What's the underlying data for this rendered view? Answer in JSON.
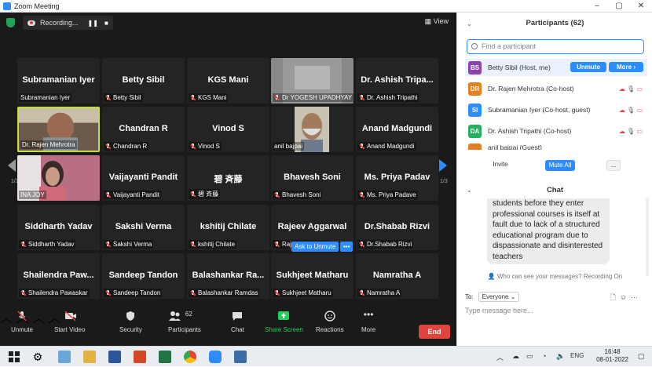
{
  "window": {
    "title": "Zoom Meeting",
    "min": "–",
    "max": "▢",
    "close": "✕"
  },
  "topbar": {
    "recording": "Recording...",
    "pause": "❚❚",
    "stop": "■",
    "view": "View"
  },
  "tiles": [
    {
      "big": "Subramanian Iyer",
      "small": "Subramanian Iyer",
      "muted": false
    },
    {
      "big": "Betty Sibil",
      "small": "Betty Sibil",
      "muted": true
    },
    {
      "big": "KGS Mani",
      "small": "KGS Mani",
      "muted": true
    },
    {
      "big": "",
      "small": "Dr YOGESH UPADHYAY",
      "muted": true,
      "video": "blur"
    },
    {
      "big": "Dr. Ashish Tripa...",
      "small": "Dr. Ashish Tripathi",
      "muted": true
    },
    {
      "big": "",
      "small": "Dr. Rajen Mehrotra",
      "muted": false,
      "video": "man",
      "active": true
    },
    {
      "big": "Chandran R",
      "small": "Chandran R",
      "muted": true
    },
    {
      "big": "Vinod S",
      "small": "Vinod S",
      "muted": true
    },
    {
      "big": "",
      "small": "anil bajpai",
      "muted": false,
      "video": "elder"
    },
    {
      "big": "Anand Madgundi",
      "small": "Anand Madgundi",
      "muted": true
    },
    {
      "big": "",
      "small": "INA JOY",
      "muted": false,
      "video": "woman"
    },
    {
      "big": "Vaijayanti Pandit",
      "small": "Vaijayanti Pandit",
      "muted": true
    },
    {
      "big": "碧 斉藤",
      "small": "碧 斉藤",
      "muted": true
    },
    {
      "big": "Bhavesh Soni",
      "small": "Bhavesh Soni",
      "muted": true
    },
    {
      "big": "Ms. Priya Padav",
      "small": "Ms. Priya Padave",
      "muted": true
    },
    {
      "big": "Siddharth Yadav",
      "small": "Siddharth Yadav",
      "muted": true
    },
    {
      "big": "Sakshi Verma",
      "small": "Sakshi Verma",
      "muted": true
    },
    {
      "big": "kshitij Chilate",
      "small": "kshitij Chilate",
      "muted": true
    },
    {
      "big": "Rajeev Aggarwal",
      "small": "Rajeev Aggarwal",
      "muted": true
    },
    {
      "big": "Dr.Shabab Rizvi",
      "small": "Dr.Shabab Rizvi",
      "muted": true
    },
    {
      "big": "Shailendra Paw...",
      "small": "Shailendra Pawaskar",
      "muted": true
    },
    {
      "big": "Sandeep Tandon",
      "small": "Sandeep Tandon",
      "muted": true
    },
    {
      "big": "Balashankar Ra...",
      "small": "Balashankar Ramdas",
      "muted": true
    },
    {
      "big": "Sukhjeet Matharu",
      "small": "Sukhjeet Matharu",
      "muted": true
    },
    {
      "big": "Namratha A",
      "small": "Namratha A",
      "muted": true
    }
  ],
  "pager": {
    "left": "1/3",
    "right": "1/3"
  },
  "ask_unmute": "Ask to Unmute",
  "ask_more": "•••",
  "toolbar": {
    "unmute": "Unmute",
    "video": "Start Video",
    "security": "Security",
    "participants": "Participants",
    "participants_count": "62",
    "chat": "Chat",
    "share": "Share Screen",
    "reactions": "Reactions",
    "more": "More",
    "end": "End"
  },
  "participants_panel": {
    "title": "Participants (62)",
    "search_placeholder": "Find a participant",
    "rows": [
      {
        "initials": "BS",
        "name": "Betty Sibil (Host, me)",
        "color": "#8e44ad"
      },
      {
        "initials": "DR",
        "name": "Dr. Rajen Mehrotra (Co-host)",
        "color": "#e67e22"
      },
      {
        "initials": "SI",
        "name": "Subramanian Iyer (Co-host, guest)",
        "color": "#2d8cff"
      },
      {
        "initials": "DA",
        "name": "Dr. Ashish Tripathi (Co-host)",
        "color": "#27ae60"
      },
      {
        "initials": "",
        "name": "anil bajpai (Guest)",
        "color": "#e67e22"
      }
    ],
    "unmute": "Unmute",
    "more": "More ›",
    "invite": "Invite",
    "mute_all": "Mute All",
    "ellipsis": "..."
  },
  "chat": {
    "title": "Chat",
    "message": "students before they enter professional courses is itself at fault due to lack of a structured educational program due to dispassionate and disinterested teachers",
    "who_can_see": "Who can see your messages? Recording On",
    "to_label": "To:",
    "to_value": "Everyone",
    "placeholder": "Type message here..."
  },
  "taskbar": {
    "lang": "ENG",
    "time": "16:48",
    "date": "08-01-2022"
  },
  "colors": {
    "accent": "#2d8cff",
    "end": "#e0443e",
    "active_border": "#c6e03a",
    "meeting_bg": "#1a1a1a"
  }
}
